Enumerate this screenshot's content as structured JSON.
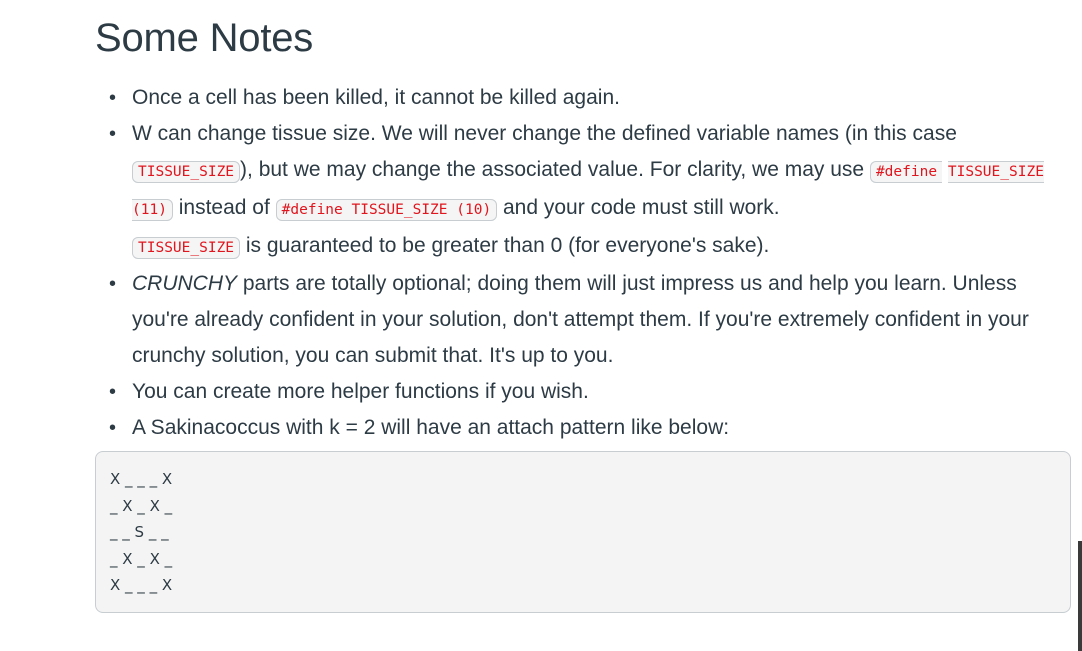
{
  "heading": "Some Notes",
  "notes": [
    {
      "text": "Once a cell has been killed, it cannot be killed again."
    },
    {
      "part1": "W can change tissue size. We will never change the defined variable names (in this case ",
      "code1": "TISSUE_SIZE",
      "part2": "), but we may change the associated value. For clarity, we may use ",
      "code2a": "#define",
      "code2b": "TISSUE_SIZE (11)",
      "part3": " instead of ",
      "code3": "#define TISSUE_SIZE (10)",
      "part4": " and your code must still work.",
      "code4": "TISSUE_SIZE",
      "part5": " is guaranteed to be greater than 0 (for everyone's sake)."
    },
    {
      "emph": "CRUNCHY",
      "text": " parts are totally optional; doing them will just impress us and help you learn. Unless you're already confident in your solution, don't attempt them. If you're extremely confident in your crunchy solution, you can submit that. It's up to you."
    },
    {
      "text": "You can create more helper functions if you wish."
    },
    {
      "text": "A Sakinacoccus with k = 2 will have an attach pattern like below:"
    }
  ],
  "pattern": "X _ _ _ X\n_ X _ X _\n_ _ S _ _\n_ X _ X _\nX _ _ _ X",
  "bullet_glyph": "•"
}
